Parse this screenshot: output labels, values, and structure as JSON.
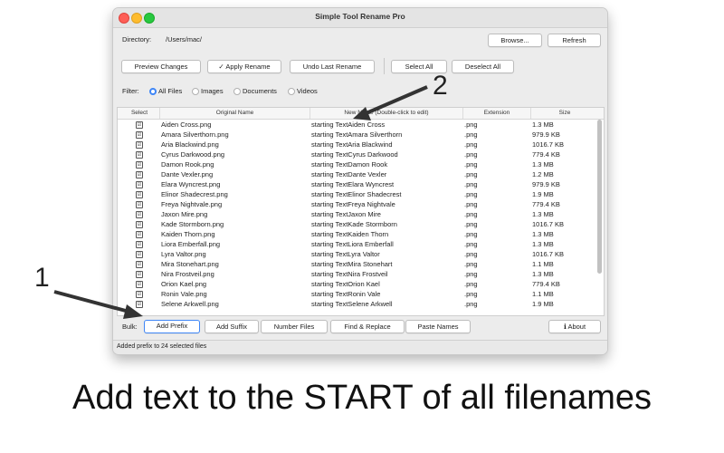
{
  "window": {
    "title": "Simple Tool Rename Pro"
  },
  "directory": {
    "label": "Directory:",
    "path": "/Users/mac/",
    "browse": "Browse...",
    "refresh": "Refresh"
  },
  "toolbar": {
    "preview": "Preview Changes",
    "apply": "✓ Apply Rename",
    "undo": "Undo Last Rename",
    "select_all": "Select All",
    "deselect_all": "Deselect All"
  },
  "filter": {
    "label": "Filter:",
    "options": [
      "All Files",
      "Images",
      "Documents",
      "Videos"
    ],
    "selected": "All Files"
  },
  "table": {
    "headers": [
      "Select",
      "Original Name",
      "New Name (Double-click to edit)",
      "Extension",
      "Size"
    ],
    "rows": [
      {
        "check": "☑",
        "orig": "Aiden Cross.png",
        "new": "starting TextAiden Cross",
        "ext": ".png",
        "size": "1.3 MB"
      },
      {
        "check": "☑",
        "orig": "Amara Silverthorn.png",
        "new": "starting TextAmara Silverthorn",
        "ext": ".png",
        "size": "979.9 KB"
      },
      {
        "check": "☑",
        "orig": "Aria Blackwind.png",
        "new": "starting TextAria Blackwind",
        "ext": ".png",
        "size": "1016.7 KB"
      },
      {
        "check": "☑",
        "orig": "Cyrus Darkwood.png",
        "new": "starting TextCyrus Darkwood",
        "ext": ".png",
        "size": "779.4 KB"
      },
      {
        "check": "☑",
        "orig": "Damon Rook.png",
        "new": "starting TextDamon Rook",
        "ext": ".png",
        "size": "1.3 MB"
      },
      {
        "check": "☑",
        "orig": "Dante Vexler.png",
        "new": "starting TextDante Vexler",
        "ext": ".png",
        "size": "1.2 MB"
      },
      {
        "check": "☑",
        "orig": "Elara Wyncrest.png",
        "new": "starting TextElara Wyncrest",
        "ext": ".png",
        "size": "979.9 KB"
      },
      {
        "check": "☑",
        "orig": "Elinor Shadecrest.png",
        "new": "starting TextElinor Shadecrest",
        "ext": ".png",
        "size": "1.9 MB"
      },
      {
        "check": "☑",
        "orig": "Freya Nightvale.png",
        "new": "starting TextFreya Nightvale",
        "ext": ".png",
        "size": "779.4 KB"
      },
      {
        "check": "☑",
        "orig": "Jaxon Mire.png",
        "new": "starting TextJaxon Mire",
        "ext": ".png",
        "size": "1.3 MB"
      },
      {
        "check": "☑",
        "orig": "Kade Stormborn.png",
        "new": "starting TextKade Stormborn",
        "ext": ".png",
        "size": "1016.7 KB"
      },
      {
        "check": "☑",
        "orig": "Kaiden Thorn.png",
        "new": "starting TextKaiden Thorn",
        "ext": ".png",
        "size": "1.3 MB"
      },
      {
        "check": "☑",
        "orig": "Liora Emberfall.png",
        "new": "starting TextLiora Emberfall",
        "ext": ".png",
        "size": "1.3 MB"
      },
      {
        "check": "☑",
        "orig": "Lyra Valtor.png",
        "new": "starting TextLyra Valtor",
        "ext": ".png",
        "size": "1016.7 KB"
      },
      {
        "check": "☑",
        "orig": "Mira Stonehart.png",
        "new": "starting TextMira Stonehart",
        "ext": ".png",
        "size": "1.1 MB"
      },
      {
        "check": "☑",
        "orig": "Nira Frostveil.png",
        "new": "starting TextNira Frostveil",
        "ext": ".png",
        "size": "1.3 MB"
      },
      {
        "check": "☑",
        "orig": "Orion Kael.png",
        "new": "starting TextOrion Kael",
        "ext": ".png",
        "size": "779.4 KB"
      },
      {
        "check": "☑",
        "orig": "Ronin Vale.png",
        "new": "starting TextRonin Vale",
        "ext": ".png",
        "size": "1.1 MB"
      },
      {
        "check": "☑",
        "orig": "Selene Arkwell.png",
        "new": "starting TextSelene Arkwell",
        "ext": ".png",
        "size": "1.9 MB"
      }
    ]
  },
  "bulk": {
    "label": "Bulk:",
    "add_prefix": "Add Prefix",
    "add_suffix": "Add Suffix",
    "number_files": "Number Files",
    "find_replace": "Find & Replace",
    "paste_names": "Paste Names",
    "about": "ℹ About"
  },
  "status": {
    "text": "Added prefix to 24 selected files"
  },
  "annotations": {
    "one": "1",
    "two": "2"
  },
  "caption": "Add text to the START of all filenames",
  "colors": {
    "accent": "#3f86f6",
    "arrow": "#333333"
  }
}
